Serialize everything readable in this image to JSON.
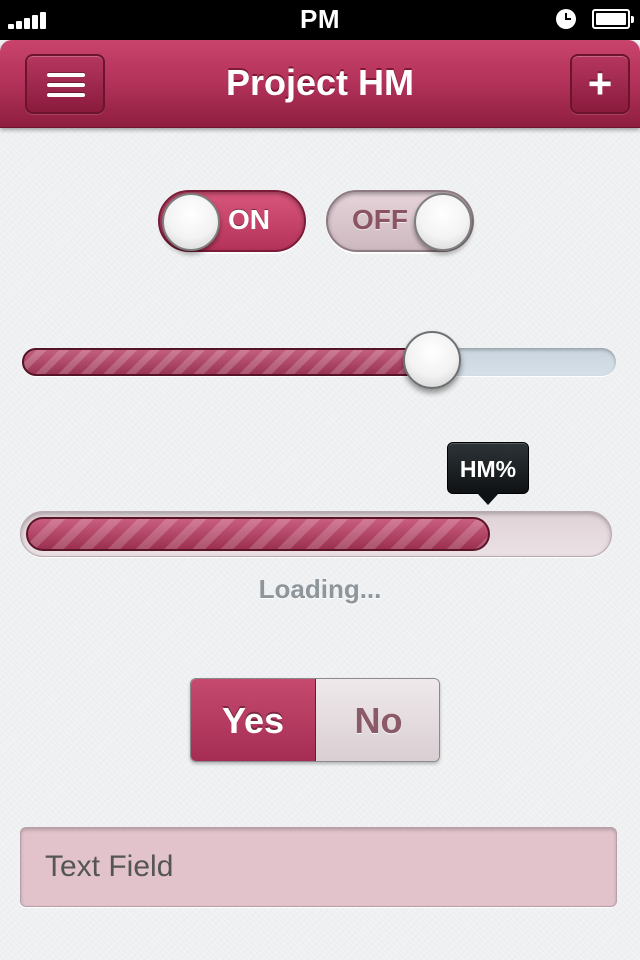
{
  "status_bar": {
    "time": "PM",
    "signal_icon": "signal-bars-icon",
    "clock_icon": "clock-icon",
    "battery_icon": "battery-icon"
  },
  "nav_bar": {
    "title": "Project HM",
    "menu_icon": "hamburger-menu-icon",
    "add_label": "+"
  },
  "toggles": {
    "on_label": "ON",
    "off_label": "OFF"
  },
  "slider": {
    "value_fraction": 0.69
  },
  "progress": {
    "tooltip": "HM%",
    "value_fraction": 0.8,
    "status_text": "Loading..."
  },
  "segmented": {
    "yes_label": "Yes",
    "no_label": "No",
    "selected": "Yes"
  },
  "text_field": {
    "placeholder": "Text Field"
  },
  "colors": {
    "accent": "#b2325a",
    "background": "#eef0f2",
    "tooltip": "#1a1f22",
    "text_field_bg": "#e2c3cc"
  }
}
